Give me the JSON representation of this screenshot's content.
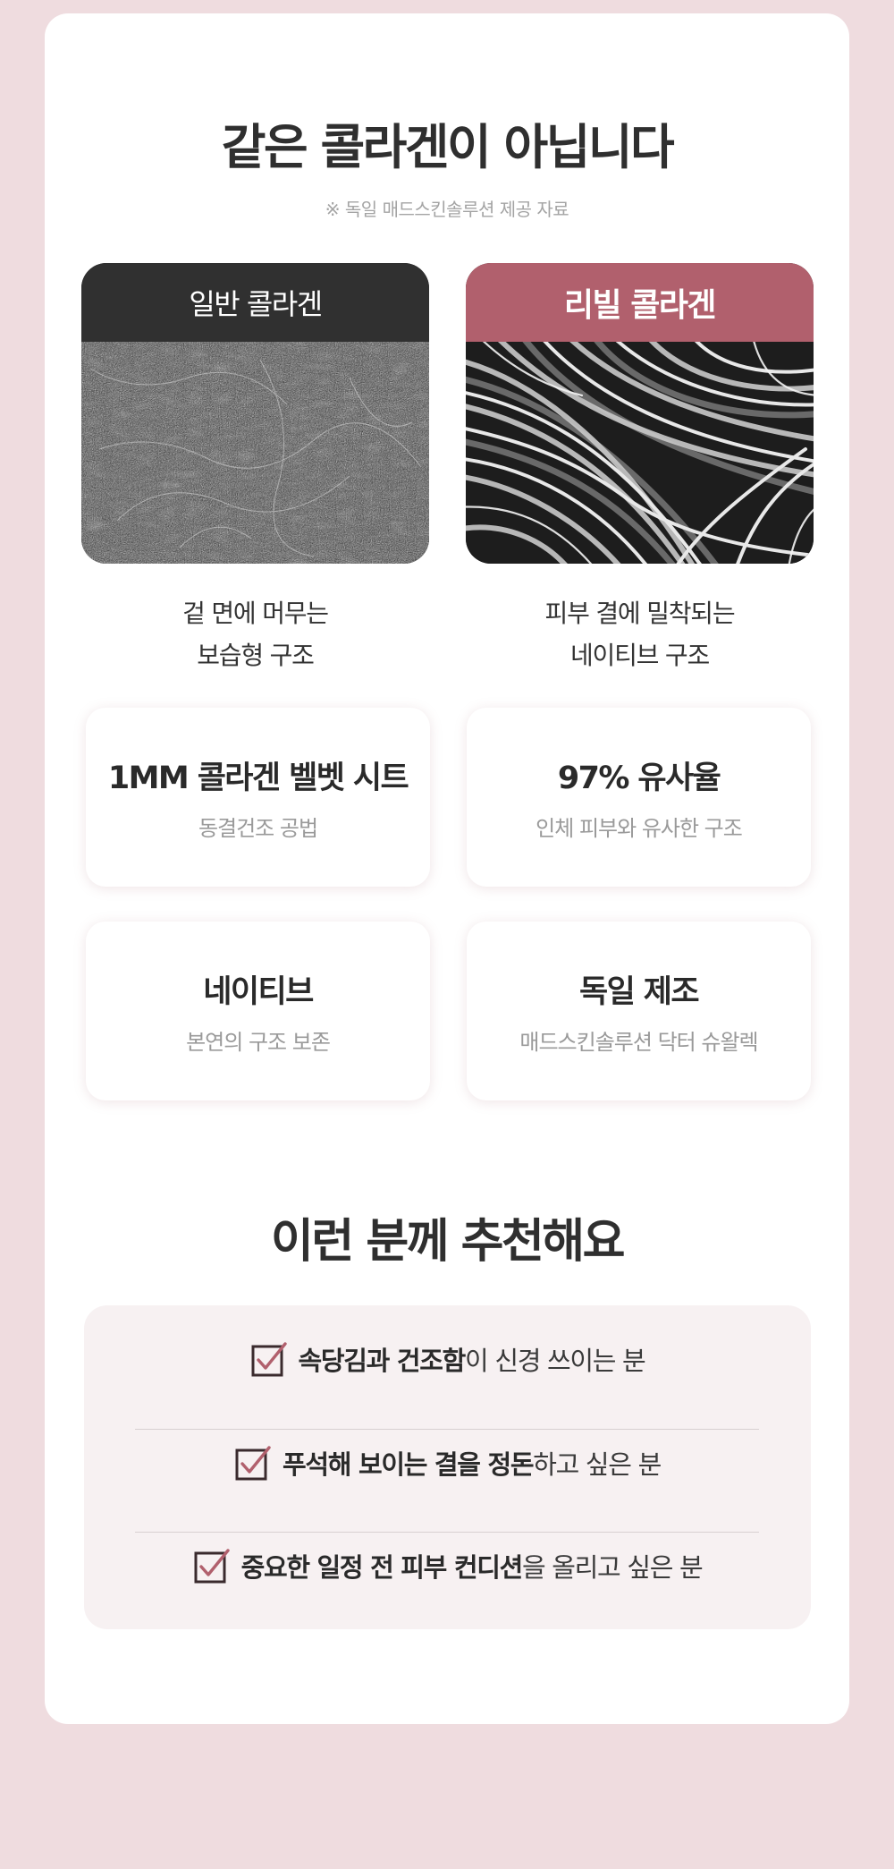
{
  "header": {
    "title": "같은 콜라겐이 아닙니다",
    "subtitle": "※ 독일 매드스킨솔루션 제공 자료"
  },
  "comparison": {
    "left": {
      "label": "일반 콜라겐",
      "desc_line1": "겉 면에 머무는",
      "desc_line2": "보습형 구조"
    },
    "right": {
      "label": "리빌 콜라겐",
      "desc_line1": "피부 결에 밀착되는",
      "desc_line2": "네이티브 구조"
    }
  },
  "features": [
    {
      "title": "1MM 콜라겐 벨벳 시트",
      "sub": "동결건조 공법"
    },
    {
      "title": "97% 유사율",
      "sub": "인체 피부와 유사한 구조"
    },
    {
      "title": "네이티브",
      "sub": "본연의 구조 보존"
    },
    {
      "title": "독일 제조",
      "sub": "매드스킨솔루션 닥터 슈왈렉"
    }
  ],
  "recommend": {
    "title": "이런 분께 추천해요",
    "items": [
      {
        "bold": "속당김과 건조함",
        "rest": "이 신경 쓰이는 분"
      },
      {
        "bold": "푸석해 보이는 결을 정돈",
        "rest": "하고 싶은 분"
      },
      {
        "bold": "중요한 일정 전 피부 컨디션",
        "rest": "을 올리고 싶은 분"
      }
    ]
  },
  "colors": {
    "page_background": "#efdcdf",
    "card_background": "#ffffff",
    "left_header": "#303030",
    "right_header": "#b1606d",
    "check_accent": "#b1606d",
    "recommend_box": "#f7f1f2"
  },
  "icons": {
    "checkbox": "checkbox-checked-icon"
  }
}
